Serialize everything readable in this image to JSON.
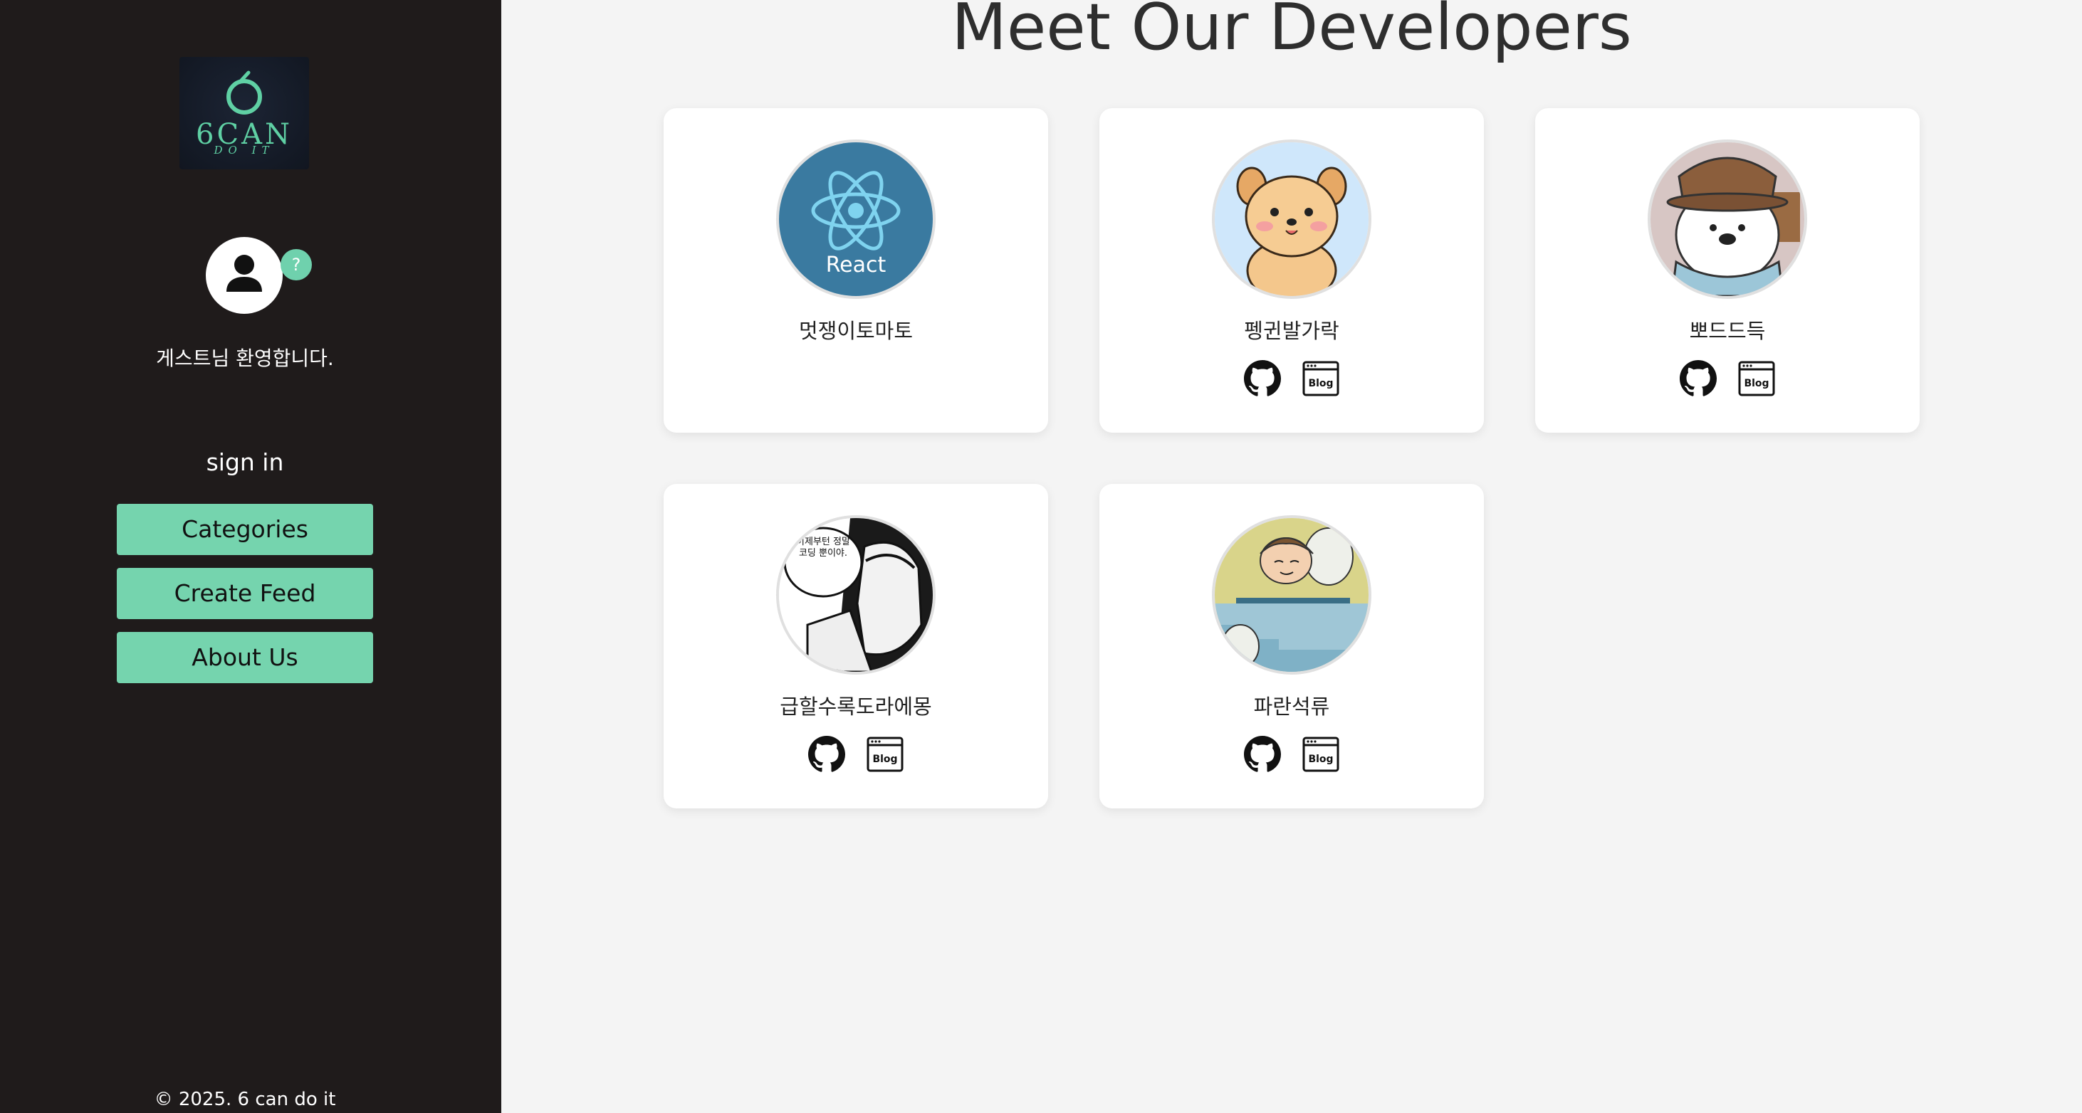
{
  "sidebar": {
    "logo": {
      "main": "6CAN",
      "sub": "DO IT"
    },
    "help_badge": "?",
    "welcome": "게스트님 환영합니다.",
    "sign_in": "sign in",
    "nav": [
      {
        "label": "Categories"
      },
      {
        "label": "Create Feed"
      },
      {
        "label": "About Us"
      }
    ],
    "footer": "© 2025. 6 can do it"
  },
  "main": {
    "title": "Meet Our Developers",
    "developers": [
      {
        "name": "멋쟁이토마토",
        "avatar_label": "React",
        "links": []
      },
      {
        "name": "펭귄발가락",
        "links": [
          "github",
          "blog"
        ]
      },
      {
        "name": "뽀드드득",
        "links": [
          "github",
          "blog"
        ]
      },
      {
        "name": "급할수록도라에몽",
        "avatar_text": "이제부턴 정말 코딩 뿐이야.",
        "links": [
          "github",
          "blog"
        ]
      },
      {
        "name": "파란석류",
        "links": [
          "github",
          "blog"
        ]
      }
    ],
    "blog_icon_label": "Blog"
  },
  "colors": {
    "sidebar_bg": "#1f1b1b",
    "accent": "#75d4ae",
    "page_bg": "#f4f4f4",
    "react_bg": "#3a7aa0"
  },
  "icons": [
    "user-icon",
    "github-icon",
    "blog-icon",
    "react-icon"
  ]
}
